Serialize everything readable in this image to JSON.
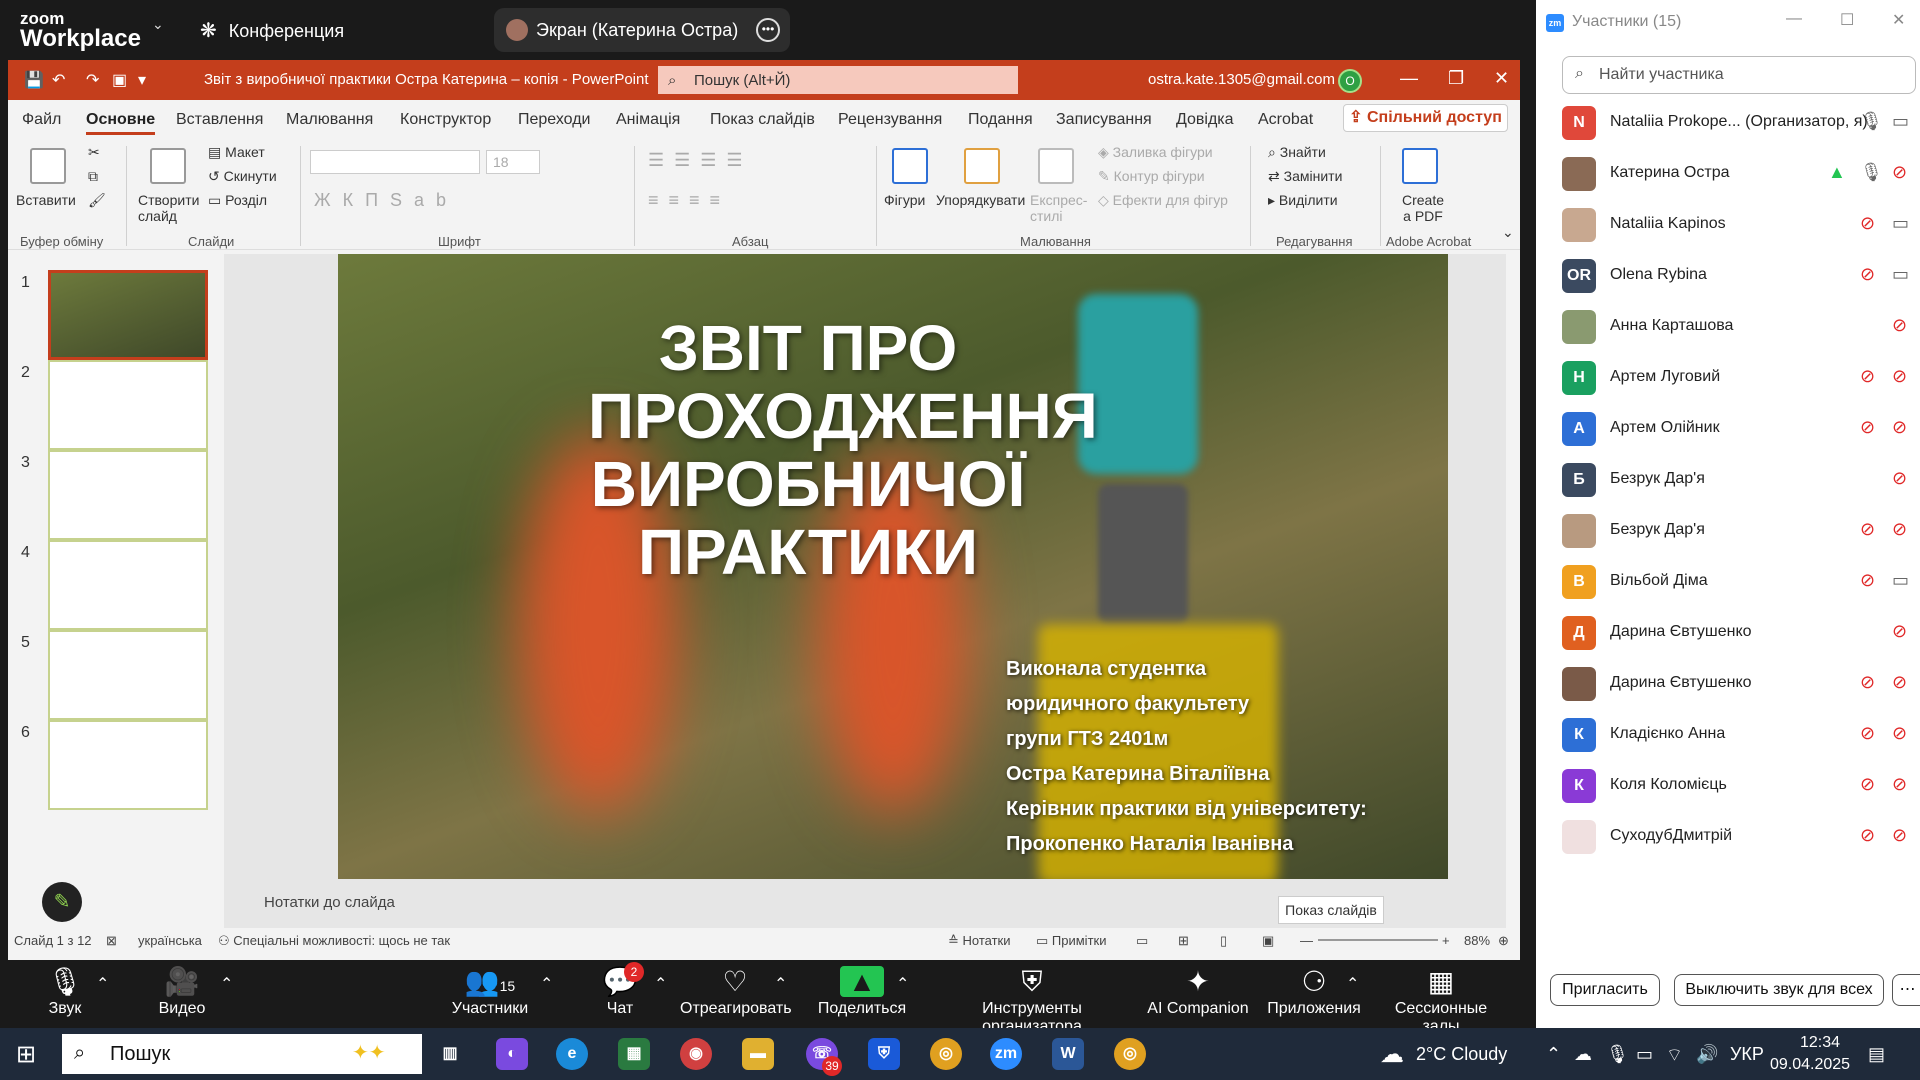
{
  "zoom_top": {
    "logo_line1": "zoom",
    "logo_line2": "Workplace",
    "meeting_label": "Конференция",
    "screen_share_label": "Экран (Катерина Остра)"
  },
  "ppt": {
    "title": "Звіт з виробничої практики Остра Катерина – копія  -  PowerPoint",
    "search_placeholder": "Пошук (Alt+Й)",
    "email": "ostra.kate.1305@gmail.com",
    "avatar_letter": "O",
    "menu": [
      "Файл",
      "Основне",
      "Вставлення",
      "Малювання",
      "Конструктор",
      "Переходи",
      "Анімація",
      "Показ слайдів",
      "Рецензування",
      "Подання",
      "Записування",
      "Довідка",
      "Acrobat"
    ],
    "share_label": "Спільний доступ",
    "ribbon": {
      "paste": "Вставити",
      "clipboard": "Буфер обміну",
      "new_slide": "Створити слайд",
      "layout": "Макет",
      "reset": "Скинути",
      "section": "Розділ",
      "slides": "Слайди",
      "font_size": "18",
      "font_group": "Шрифт",
      "paragraph": "Абзац",
      "shapes": "Фігури",
      "arrange": "Упорядкувати",
      "quick_styles": "Експрес-стилі",
      "shape_fill": "Заливка фігури",
      "shape_outline": "Контур фігури",
      "shape_effects": "Ефекти для фігур",
      "drawing": "Малювання",
      "find": "Знайти",
      "replace": "Замінити",
      "select": "Виділити",
      "editing": "Редагування",
      "create_pdf": "Create a PDF",
      "adobe": "Adobe Acrobat"
    },
    "slide_numbers": [
      "1",
      "2",
      "3",
      "4",
      "5",
      "6"
    ],
    "slide": {
      "title": "ЗВІТ ПРО ПРОХОДЖЕННЯ ВИРОБНИЧОЇ ПРАКТИКИ",
      "info": [
        "Виконала студентка",
        "юридичного факультету",
        "групи ГТЗ 2401м",
        "Остра Катерина Віталіївна",
        "Керівник практики від університету:",
        "Прокопенко Наталія Іванівна"
      ]
    },
    "notes_label": "Нотатки до слайда",
    "status": {
      "slide_count": "Слайд 1 з 12",
      "language": "українська",
      "accessibility": "Спеціальні можливості: щось не так",
      "notes": "Нотатки",
      "comments": "Примітки",
      "zoom": "88%"
    },
    "tooltip": "Показ слайдів"
  },
  "toolbar": [
    {
      "label": "Звук",
      "icon": "mic"
    },
    {
      "label": "Видео",
      "icon": "video"
    },
    {
      "label": "Участники",
      "icon": "participants",
      "count": "15"
    },
    {
      "label": "Чат",
      "icon": "chat",
      "badge": "2"
    },
    {
      "label": "Отреагировать",
      "icon": "heart"
    },
    {
      "label": "Поделиться",
      "icon": "share"
    },
    {
      "label": "Инструменты организатора",
      "icon": "shield"
    },
    {
      "label": "AI Companion",
      "icon": "sparkle"
    },
    {
      "label": "Приложения",
      "icon": "apps"
    },
    {
      "label": "Сессионные залы",
      "icon": "rooms"
    }
  ],
  "participants": {
    "title": "Участники (15)",
    "search_placeholder": "Найти участника",
    "list": [
      {
        "name": "Nataliia Prokope... (Организатор, я)",
        "initial": "N",
        "color": "#e0483a"
      },
      {
        "name": "Катерина Остра",
        "initial": "",
        "color": "#8a6a55"
      },
      {
        "name": "Nataliia Kapinos",
        "initial": "",
        "color": "#c8a890"
      },
      {
        "name": "Olena Rybina",
        "initial": "OR",
        "color": "#3b4a60"
      },
      {
        "name": "Анна Карташова",
        "initial": "",
        "color": "#8a9a70"
      },
      {
        "name": "Артем Луговий",
        "initial": "Н",
        "color": "#1aa060"
      },
      {
        "name": "Артем Олійник",
        "initial": "А",
        "color": "#2d6fd6"
      },
      {
        "name": "Безрук Дар'я",
        "initial": "Б",
        "color": "#3b4a60"
      },
      {
        "name": "Безрук Дар'я",
        "initial": "",
        "color": "#b89a80"
      },
      {
        "name": "Вільбой Діма",
        "initial": "В",
        "color": "#f0a020"
      },
      {
        "name": "Дарина Євтушенко",
        "initial": "Д",
        "color": "#e06020"
      },
      {
        "name": "Дарина Євтушенко",
        "initial": "",
        "color": "#7a5a48"
      },
      {
        "name": "Кладієнко Анна",
        "initial": "К",
        "color": "#2d6fd6"
      },
      {
        "name": "Коля Коломієць",
        "initial": "К",
        "color": "#8a3ad6"
      },
      {
        "name": "СуходубДмитрій",
        "initial": "",
        "color": "#f0e0e0"
      }
    ],
    "invite": "Пригласить",
    "mute_all": "Выключить звук для всех"
  },
  "taskbar": {
    "search": "Пошук",
    "weather": "2°C  Cloudy",
    "lang": "УКР",
    "time": "12:34",
    "date": "09.04.2025",
    "viber_badge": "39"
  }
}
